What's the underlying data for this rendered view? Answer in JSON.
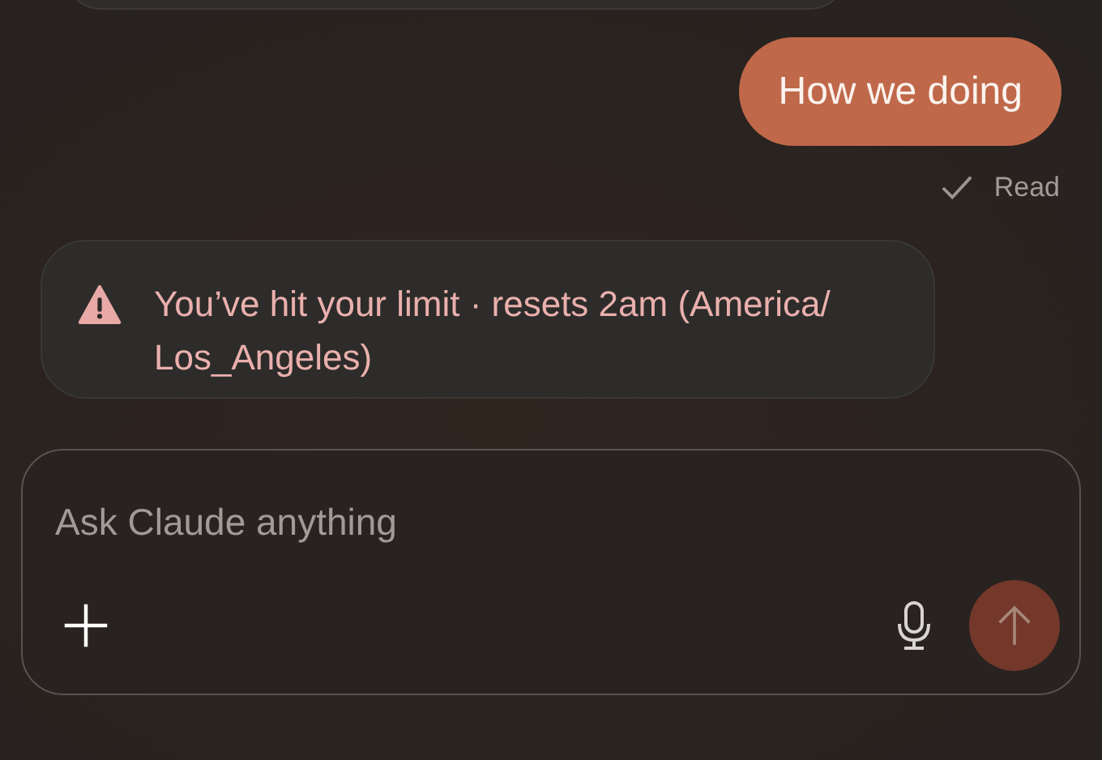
{
  "messages": [
    {
      "kind": "assistant_cut"
    },
    {
      "kind": "user",
      "text": "How we doing",
      "receipt": "Read"
    },
    {
      "kind": "warning",
      "text": "You’ve hit your limit · resets 2am (America/ Los_Angeles)"
    }
  ],
  "composer": {
    "placeholder": "Ask Claude anything",
    "send_disabled": true
  }
}
